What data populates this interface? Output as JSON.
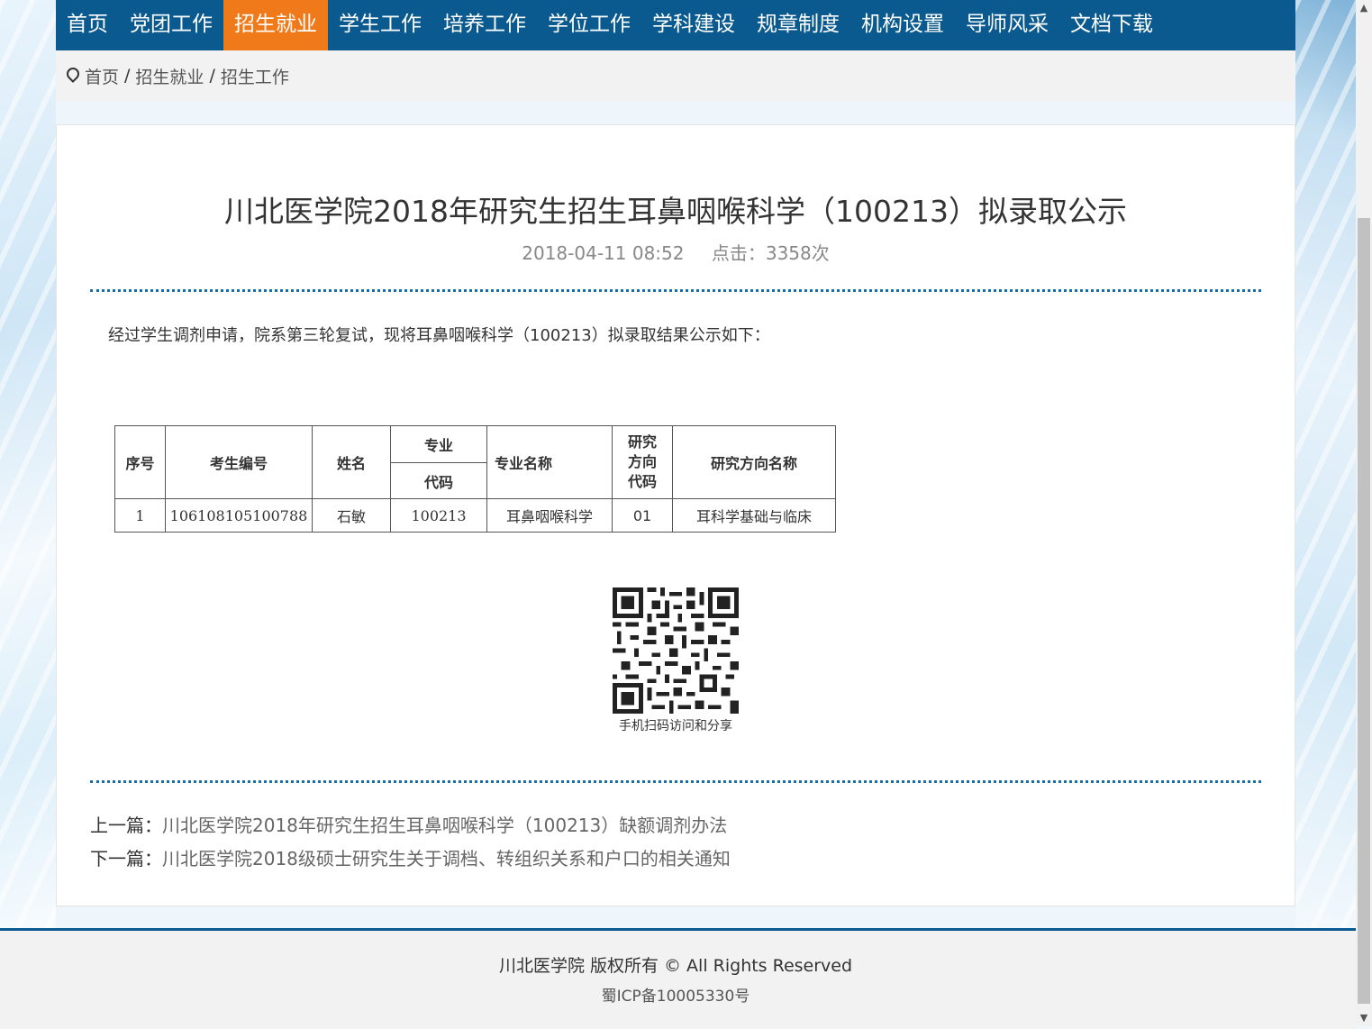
{
  "nav": {
    "items": [
      {
        "label": "首页"
      },
      {
        "label": "党团工作"
      },
      {
        "label": "招生就业"
      },
      {
        "label": "学生工作"
      },
      {
        "label": "培养工作"
      },
      {
        "label": "学位工作"
      },
      {
        "label": "学科建设"
      },
      {
        "label": "规章制度"
      },
      {
        "label": "机构设置"
      },
      {
        "label": "导师风采"
      },
      {
        "label": "文档下载"
      }
    ],
    "active": "招生就业",
    "colors": {
      "bar": "#0a5a8f",
      "active": "#f07a1a"
    }
  },
  "breadcrumb": {
    "icon": "map-marker-icon",
    "items": [
      "首页",
      "招生就业",
      "招生工作"
    ],
    "separator": "/"
  },
  "article": {
    "title": "川北医学院2018年研究生招生耳鼻咽喉科学（100213）拟录取公示",
    "date": "2018-04-11 08:52",
    "clicks": "点击：3358次",
    "intro": "经过学生调剂申请，院系第三轮复试，现将耳鼻咽喉科学（100213）拟录取结果公示如下：",
    "table": {
      "headers": {
        "seq": "序号",
        "exam_no": "考生编号",
        "name": "姓名",
        "major_code_1": "专业",
        "major_code_2": "代码",
        "major_name": "专业名称",
        "direction_code": "研究方向代码",
        "direction_name": "研究方向名称"
      },
      "rows": [
        {
          "seq": "1",
          "exam_no": "106108105100788",
          "name": "石敏",
          "major_code": "100213",
          "major_name": "耳鼻咽喉科学",
          "direction_code": "01",
          "direction_name": "耳科学基础与临床"
        }
      ]
    },
    "qr_caption": "手机扫码访问和分享",
    "prev_label": "上一篇：",
    "prev_title": "川北医学院2018年研究生招生耳鼻咽喉科学（100213）缺额调剂办法",
    "next_label": "下一篇：",
    "next_title": "川北医学院2018级硕士研究生关于调档、转组织关系和户口的相关通知"
  },
  "footer": {
    "copyright": "川北医学院 版权所有 © All Rights Reserved",
    "icp": "蜀ICP备10005330号"
  }
}
